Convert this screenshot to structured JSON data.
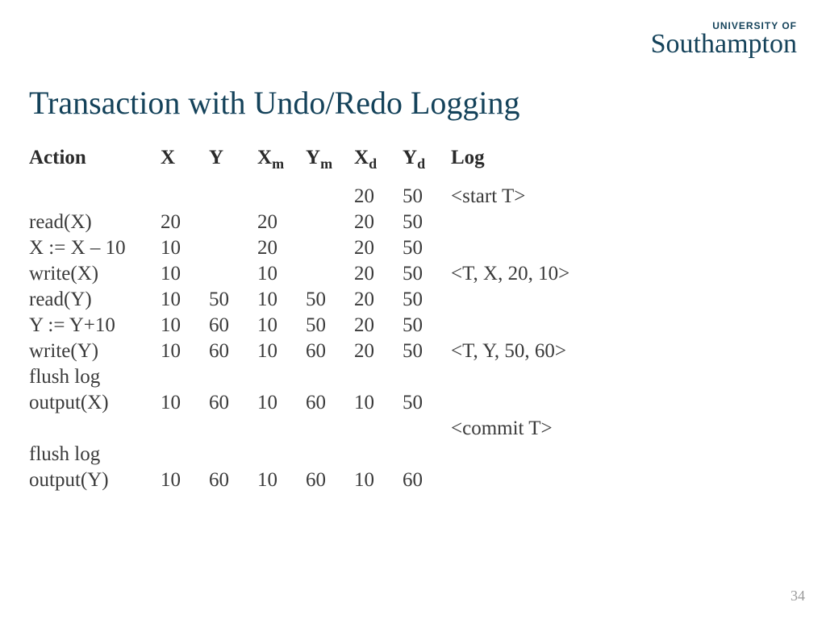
{
  "logo": {
    "small": "UNIVERSITY OF",
    "big_a": "Southam",
    "big_b": "pton"
  },
  "title": "Transaction with Undo/Redo Logging",
  "headers": {
    "action": "Action",
    "x": "X",
    "y": "Y",
    "xm": "X",
    "xm_sub": "m",
    "ym": "Y",
    "ym_sub": "m",
    "xd": "X",
    "xd_sub": "d",
    "yd": "Y",
    "yd_sub": "d",
    "log": "Log"
  },
  "rows": [
    {
      "action": "",
      "x": "",
      "y": "",
      "xm": "",
      "ym": "",
      "xd": "20",
      "yd": "50",
      "log": "<start T>"
    },
    {
      "action": "read(X)",
      "x": "20",
      "y": "",
      "xm": "20",
      "ym": "",
      "xd": "20",
      "yd": "50",
      "log": ""
    },
    {
      "action": "X := X – 10",
      "x": "10",
      "y": "",
      "xm": "20",
      "ym": "",
      "xd": "20",
      "yd": "50",
      "log": ""
    },
    {
      "action": "write(X)",
      "x": "10",
      "y": "",
      "xm": "10",
      "ym": "",
      "xd": "20",
      "yd": "50",
      "log": "<T, X, 20, 10>"
    },
    {
      "action": "read(Y)",
      "x": "10",
      "y": "50",
      "xm": "10",
      "ym": "50",
      "xd": "20",
      "yd": "50",
      "log": ""
    },
    {
      "action": "Y := Y+10",
      "x": "10",
      "y": "60",
      "xm": "10",
      "ym": "50",
      "xd": "20",
      "yd": "50",
      "log": ""
    },
    {
      "action": "write(Y)",
      "x": "10",
      "y": "60",
      "xm": "10",
      "ym": "60",
      "xd": "20",
      "yd": "50",
      "log": "<T, Y, 50, 60>"
    },
    {
      "action": "flush log",
      "x": "",
      "y": "",
      "xm": "",
      "ym": "",
      "xd": "",
      "yd": "",
      "log": ""
    },
    {
      "action": "output(X)",
      "x": "10",
      "y": "60",
      "xm": "10",
      "ym": "60",
      "xd": "10",
      "yd": "50",
      "log": ""
    },
    {
      "action": "",
      "x": "",
      "y": "",
      "xm": "",
      "ym": "",
      "xd": "",
      "yd": "",
      "log": "<commit T>"
    },
    {
      "action": "flush log",
      "x": "",
      "y": "",
      "xm": "",
      "ym": "",
      "xd": "",
      "yd": "",
      "log": ""
    },
    {
      "action": "output(Y)",
      "x": "10",
      "y": "60",
      "xm": "10",
      "ym": "60",
      "xd": "10",
      "yd": "60",
      "log": ""
    }
  ],
  "page_number": "34"
}
